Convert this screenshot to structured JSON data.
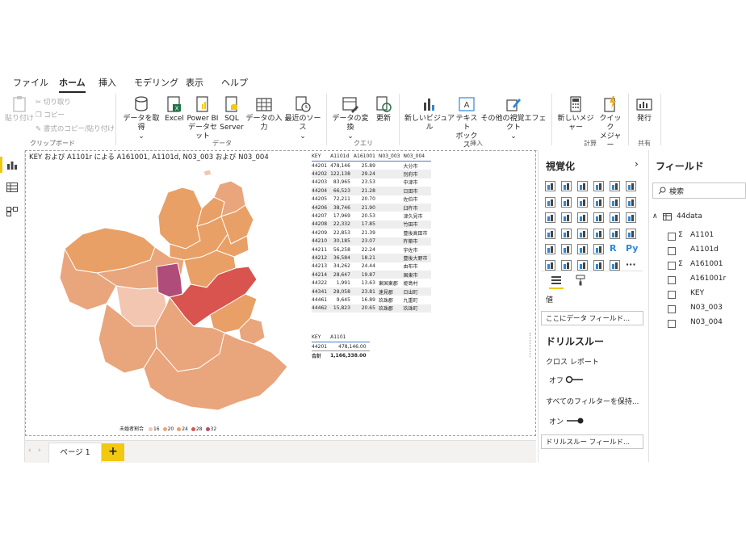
{
  "ribbon": {
    "tabs": [
      "ファイル",
      "ホーム",
      "挿入",
      "モデリング",
      "表示",
      "ヘルプ"
    ],
    "active_tab": "ホーム",
    "clipboard": {
      "paste": "貼り付け",
      "cut": "切り取り",
      "copy": "コピー",
      "format_painter": "書式のコピー/貼り付け",
      "group": "クリップボード"
    },
    "data": {
      "get_data": "データを取得",
      "get_data_arrow": "⌄",
      "excel": "Excel",
      "pbi_line1": "Power BI",
      "pbi_line2": "データセット",
      "sql_line1": "SQL",
      "sql_line2": "Server",
      "enter_data": "データの入力",
      "recent_sources": "最近のソース",
      "recent_arrow": "⌄",
      "group": "データ"
    },
    "query": {
      "transform": "データの変換",
      "transform_arrow": "⌄",
      "refresh": "更新",
      "group": "クエリ"
    },
    "insert": {
      "new_visual": "新しいビジュアル",
      "textbox_line1": "テキスト",
      "textbox_line2": "ボックス",
      "more_visuals": "その他の視覚エフェクト",
      "more_arrow": "⌄",
      "group": "挿入"
    },
    "calc": {
      "new_measure": "新しいメジャー",
      "quick_line1": "クイック",
      "quick_line2": "メジャー",
      "group": "計算"
    },
    "share": {
      "publish": "発行",
      "group": "共有"
    }
  },
  "report": {
    "map_title": "KEY および A1101r による A161001, A1101d, N03_003 および N03_004",
    "legend_title": "未婚者割合",
    "legend_items": [
      {
        "label": "16",
        "color": "#f2c6b0"
      },
      {
        "label": "20",
        "color": "#e9a57c"
      },
      {
        "label": "24",
        "color": "#e8a066"
      },
      {
        "label": "28",
        "color": "#d9534f"
      },
      {
        "label": "32",
        "color": "#b04c7a"
      }
    ],
    "table1": {
      "headers": [
        "KEY",
        "A1101d",
        "A161001",
        "N03_003",
        "N03_004"
      ],
      "rows": [
        [
          "44201",
          "478,146",
          "25.89",
          "",
          "大分市"
        ],
        [
          "44202",
          "122,138",
          "29.24",
          "",
          "別府市"
        ],
        [
          "44203",
          "83,965",
          "23.53",
          "",
          "中津市"
        ],
        [
          "44204",
          "66,523",
          "21.28",
          "",
          "日田市"
        ],
        [
          "44205",
          "72,211",
          "20.70",
          "",
          "佐伯市"
        ],
        [
          "44206",
          "38,746",
          "21.90",
          "",
          "臼杵市"
        ],
        [
          "44207",
          "17,969",
          "20.53",
          "",
          "津久見市"
        ],
        [
          "44208",
          "22,332",
          "17.85",
          "",
          "竹田市"
        ],
        [
          "44209",
          "22,853",
          "21.39",
          "",
          "豊後高田市"
        ],
        [
          "44210",
          "30,185",
          "23.07",
          "",
          "杵築市"
        ],
        [
          "44211",
          "56,258",
          "22.24",
          "",
          "宇佐市"
        ],
        [
          "44212",
          "36,584",
          "18.21",
          "",
          "豊後大野市"
        ],
        [
          "44213",
          "34,262",
          "24.44",
          "",
          "由布市"
        ],
        [
          "44214",
          "28,647",
          "19.87",
          "",
          "国東市"
        ],
        [
          "44322",
          "1,991",
          "13.63",
          "東国東郡",
          "姫島村"
        ],
        [
          "44341",
          "28,058",
          "23.81",
          "速見郡",
          "日出町"
        ],
        [
          "44461",
          "9,645",
          "16.89",
          "玖珠郡",
          "九重町"
        ],
        [
          "44462",
          "15,823",
          "20.65",
          "玖珠郡",
          "玖珠町"
        ]
      ]
    },
    "table2": {
      "headers": [
        "KEY",
        "A1101"
      ],
      "rows": [
        [
          "44201",
          "478,146.00"
        ]
      ],
      "total_label": "合計",
      "total_value": "1,166,338.00"
    },
    "page_tab": "ページ 1",
    "add_page": "+"
  },
  "viz_pane": {
    "title": "視覚化",
    "collapse_glyph": "›",
    "values_label": "値",
    "values_placeholder": "ここにデータ フィールド...",
    "drill_title": "ドリルスルー",
    "cross_report": "クロス レポート",
    "off_label": "オフ",
    "keep_filters": "すべてのフィルターを保持...",
    "on_label": "オン",
    "drill_placeholder": "ドリルスルー フィールド...",
    "more_glyph": "···",
    "r_label": "R",
    "py_label": "Py"
  },
  "fields_pane": {
    "title": "フィールド",
    "search_placeholder": "検索",
    "table_name": "44data",
    "fields": [
      {
        "name": "A1101",
        "sigma": true
      },
      {
        "name": "A1101d",
        "sigma": false
      },
      {
        "name": "A161001",
        "sigma": true
      },
      {
        "name": "A161001r",
        "sigma": false
      },
      {
        "name": "KEY",
        "sigma": false
      },
      {
        "name": "N03_003",
        "sigma": false
      },
      {
        "name": "N03_004",
        "sigma": false
      }
    ],
    "sigma_glyph": "Σ"
  }
}
